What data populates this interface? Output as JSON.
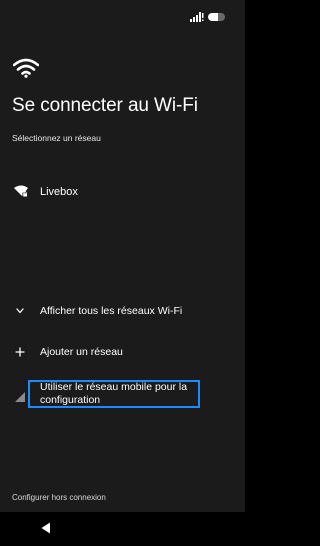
{
  "status_bar": {
    "signal_icon": "cell-signal-icon",
    "battery_icon": "battery-icon",
    "battery_level": 0.6
  },
  "header": {
    "hero_icon": "wifi-icon",
    "title": "Se connecter au Wi-Fi",
    "subtitle": "Sélectionnez un réseau"
  },
  "networks": [
    {
      "name": "Livebox",
      "icon": "wifi-locked-icon"
    }
  ],
  "actions": {
    "show_all": {
      "label": "Afficher tous les réseaux Wi-Fi",
      "icon": "chevron-down-icon"
    },
    "add": {
      "label": "Ajouter un réseau",
      "icon": "plus-icon"
    },
    "mobile": {
      "label_line1": "Utiliser le réseau mobile pour la",
      "label_line2": "configuration",
      "icon": "mobile-signal-icon",
      "focus_color": "#1a8cff"
    }
  },
  "footer": {
    "offline_label": "Configurer hors connexion"
  },
  "nav": {
    "back_icon": "back-triangle-icon"
  },
  "colors": {
    "background": "#1b1b1b",
    "text": "#ffffff",
    "focus": "#1a8cff"
  }
}
